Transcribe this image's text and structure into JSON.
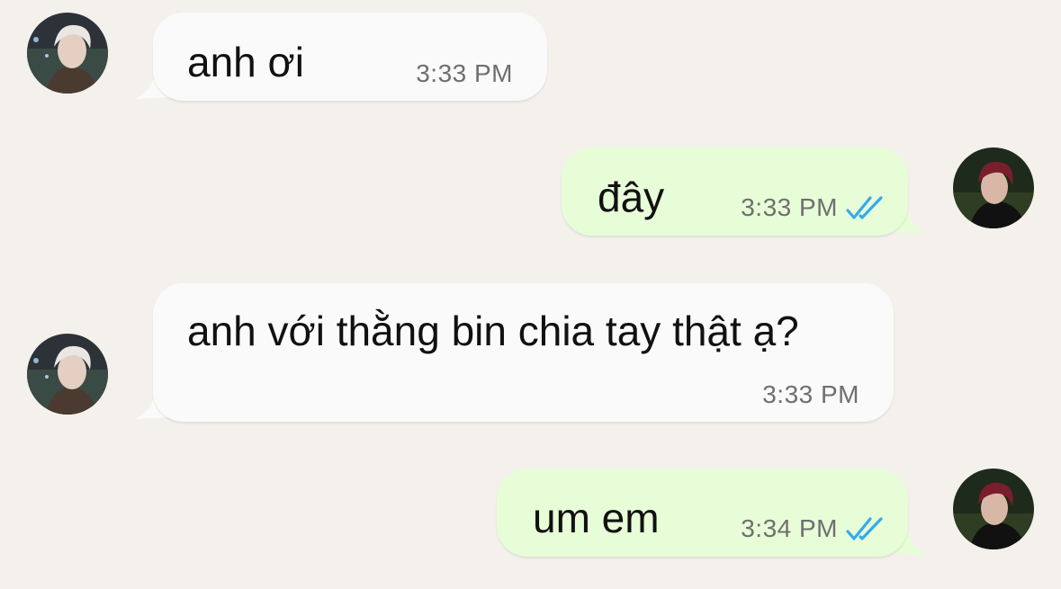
{
  "colors": {
    "background": "#f4f1ec",
    "incoming_bubble": "#fafafa",
    "outgoing_bubble": "#e7fdd7",
    "timestamp": "#6f6f6f",
    "read_ticks": "#34aaf0"
  },
  "contacts": {
    "incoming_avatar_icon": "avatar-photo-silver-hair",
    "outgoing_avatar_icon": "avatar-photo-red-hair"
  },
  "messages": [
    {
      "direction": "incoming",
      "text": "anh ơi",
      "time": "3:33 PM",
      "read": false
    },
    {
      "direction": "outgoing",
      "text": "đây",
      "time": "3:33 PM",
      "read": true
    },
    {
      "direction": "incoming",
      "text": "anh với thằng bin chia tay thật ạ?",
      "time": "3:33 PM",
      "read": false
    },
    {
      "direction": "outgoing",
      "text": "um em",
      "time": "3:34 PM",
      "read": true
    }
  ]
}
